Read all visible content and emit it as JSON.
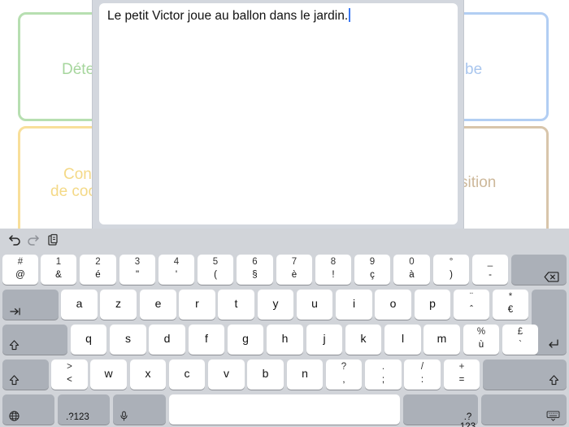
{
  "colors": {
    "card_green": "#b7dfb1",
    "card_blue": "#b2cef3",
    "card_yellow": "#f8df9a",
    "card_tan": "#d8c5ab",
    "label_green": "#a6d69d",
    "label_blue": "#a9c6ee",
    "label_yellow": "#f4d987",
    "label_tan": "#cdb89a",
    "caret": "#3a78f2"
  },
  "cards": {
    "top_left": "Déte",
    "top_right": "be",
    "bottom_left_line1": "Con",
    "bottom_left_line2": "de coo",
    "bottom_right": "sition"
  },
  "editor": {
    "text": "Le petit Victor joue au ballon dans le jardin."
  },
  "toolbar": {
    "undo_icon": "undo-icon",
    "redo_icon": "redo-icon",
    "paste_icon": "paste-icon"
  },
  "keyboard": {
    "row1": [
      {
        "top": "#",
        "bottom": "@"
      },
      {
        "top": "1",
        "bottom": "&"
      },
      {
        "top": "2",
        "bottom": "é"
      },
      {
        "top": "3",
        "bottom": "\""
      },
      {
        "top": "4",
        "bottom": "'"
      },
      {
        "top": "5",
        "bottom": "("
      },
      {
        "top": "6",
        "bottom": "§"
      },
      {
        "top": "7",
        "bottom": "è"
      },
      {
        "top": "8",
        "bottom": "!"
      },
      {
        "top": "9",
        "bottom": "ç"
      },
      {
        "top": "0",
        "bottom": "à"
      },
      {
        "top": "°",
        "bottom": ")"
      },
      {
        "top": "_",
        "bottom": "-"
      }
    ],
    "row2": [
      "a",
      "z",
      "e",
      "r",
      "t",
      "y",
      "u",
      "i",
      "o",
      "p"
    ],
    "row2_extra": [
      {
        "top": "¨",
        "bottom": "ˆ"
      },
      {
        "top": "*",
        "bottom": "€"
      }
    ],
    "row3": [
      "q",
      "s",
      "d",
      "f",
      "g",
      "h",
      "j",
      "k",
      "l",
      "m"
    ],
    "row3_extra": [
      {
        "top": "%",
        "bottom": "ù"
      },
      {
        "top": "£",
        "bottom": "`"
      }
    ],
    "row4": [
      {
        "top": ">",
        "bottom": "<"
      },
      {
        "main": "w"
      },
      {
        "main": "x"
      },
      {
        "main": "c"
      },
      {
        "main": "v"
      },
      {
        "main": "b"
      },
      {
        "main": "n"
      },
      {
        "top": "?",
        "bottom": ","
      },
      {
        "top": ".",
        "bottom": ";"
      },
      {
        "top": "/",
        "bottom": ":"
      },
      {
        "top": "+",
        "bottom": "="
      }
    ],
    "numbers_label": ".?123",
    "numbers_label_right": ".?123",
    "icons": {
      "delete": "delete-icon",
      "tab": "tab-icon",
      "caps": "caps-lock-icon",
      "return": "return-icon",
      "shift": "shift-icon",
      "globe": "globe-icon",
      "mic": "microphone-icon",
      "dismiss": "keyboard-dismiss-icon"
    }
  }
}
